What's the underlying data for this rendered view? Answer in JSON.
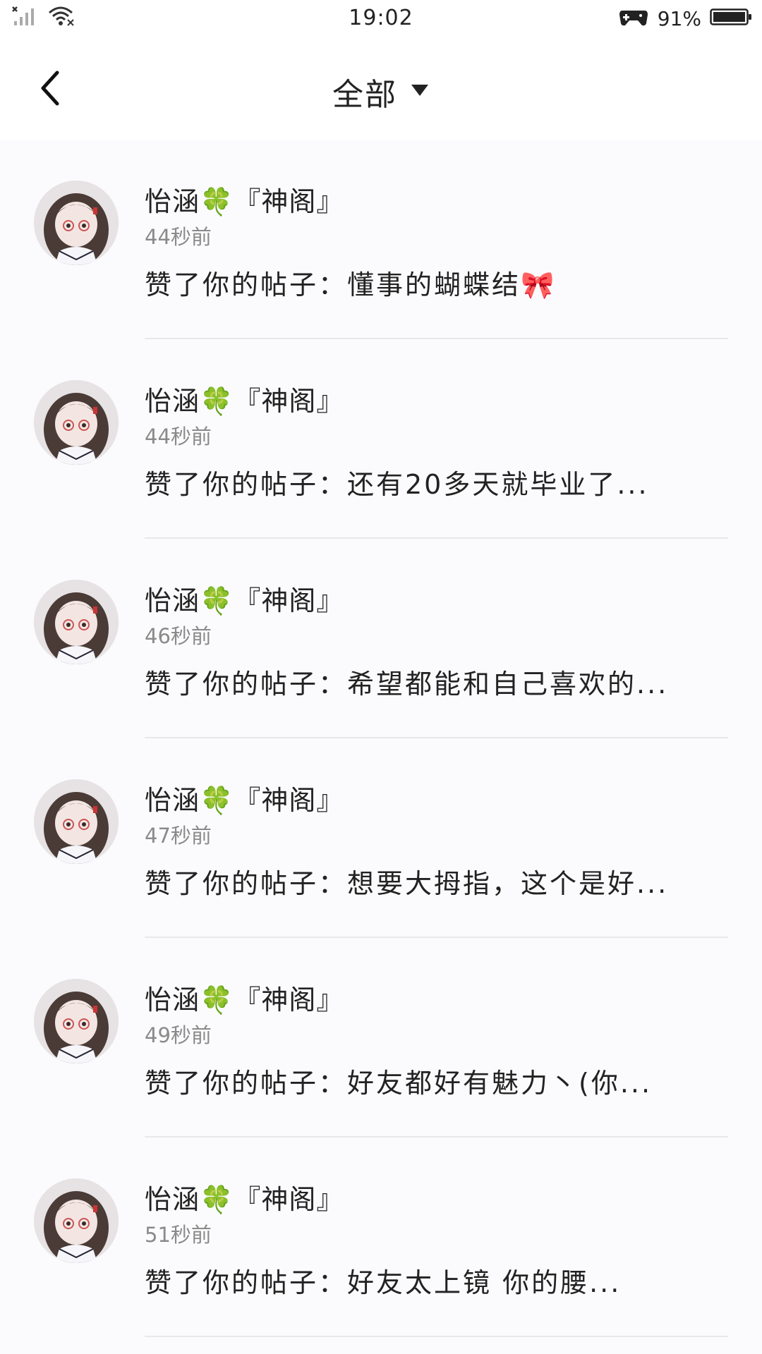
{
  "status_bar": {
    "time": "19:02",
    "battery": "91%"
  },
  "header": {
    "title": "全部"
  },
  "notifications": [
    {
      "name": "怡涵🍀『神阁』",
      "time": "44秒前",
      "message": "赞了你的帖子：懂事的蝴蝶结🎀"
    },
    {
      "name": "怡涵🍀『神阁』",
      "time": "44秒前",
      "message": "赞了你的帖子：还有20多天就毕业了..."
    },
    {
      "name": "怡涵🍀『神阁』",
      "time": "46秒前",
      "message": "赞了你的帖子：希望都能和自己喜欢的..."
    },
    {
      "name": "怡涵🍀『神阁』",
      "time": "47秒前",
      "message": "赞了你的帖子：想要大拇指，这个是好..."
    },
    {
      "name": "怡涵🍀『神阁』",
      "time": "49秒前",
      "message": "赞了你的帖子：好友都好有魅力丶(你..."
    },
    {
      "name": "怡涵🍀『神阁』",
      "time": "51秒前",
      "message": "赞了你的帖子：好友太上镜 你的腰..."
    }
  ],
  "icons": {
    "back": "chevron-left-icon",
    "dropdown": "triangle-down-icon",
    "signal": "signal-icon",
    "wifi": "wifi-icon",
    "gamepad": "gamepad-icon",
    "battery": "battery-icon"
  }
}
